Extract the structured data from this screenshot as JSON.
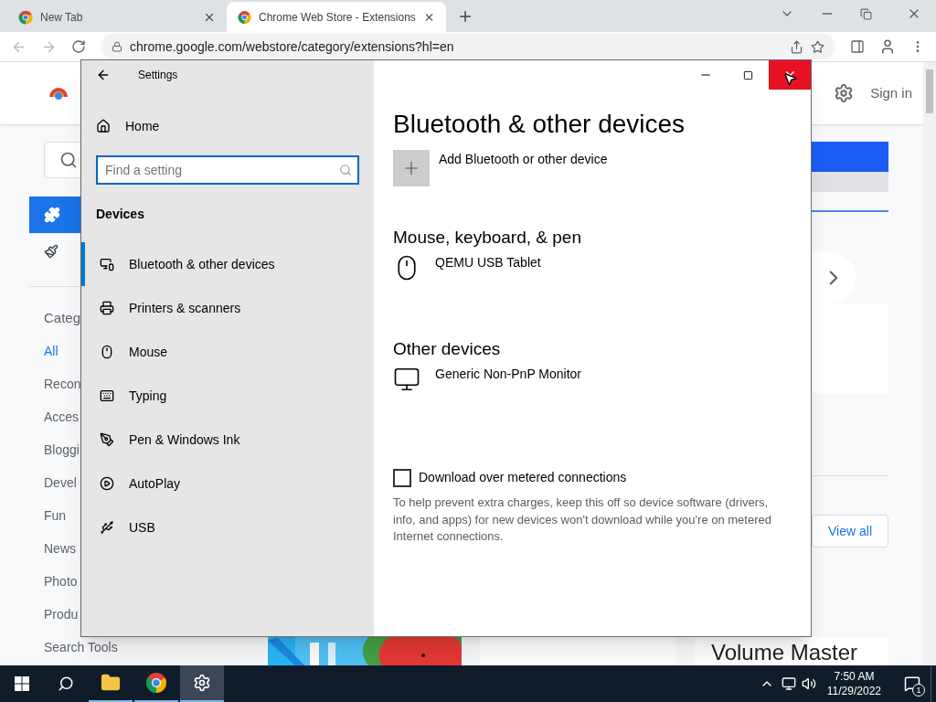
{
  "browser": {
    "tabs": [
      {
        "title": "New Tab",
        "selected": false
      },
      {
        "title": "Chrome Web Store - Extensions",
        "selected": true
      }
    ],
    "address_bar": {
      "url": "chrome.google.com/webstore/category/extensions?hl=en"
    },
    "page": {
      "sign_in": "Sign in",
      "categories_heading": "Categ",
      "categories": [
        {
          "label": "All",
          "selected": true
        },
        {
          "label": "Recon",
          "selected": false
        },
        {
          "label": "Acces",
          "selected": false
        },
        {
          "label": "Bloggi",
          "selected": false
        },
        {
          "label": "Devel",
          "selected": false
        },
        {
          "label": "Fun",
          "selected": false
        },
        {
          "label": "News",
          "selected": false
        },
        {
          "label": "Photo",
          "selected": false
        },
        {
          "label": "Produ",
          "selected": false
        },
        {
          "label": "Search Tools",
          "selected": false
        }
      ],
      "view_all": "View all",
      "card_title": "Volume Master"
    }
  },
  "settings": {
    "title": "Settings",
    "home": "Home",
    "search": {
      "placeholder": "Find a setting"
    },
    "section": "Devices",
    "nav": [
      {
        "label": "Bluetooth & other devices",
        "selected": true
      },
      {
        "label": "Printers & scanners",
        "selected": false
      },
      {
        "label": "Mouse",
        "selected": false
      },
      {
        "label": "Typing",
        "selected": false
      },
      {
        "label": "Pen & Windows Ink",
        "selected": false
      },
      {
        "label": "AutoPlay",
        "selected": false
      },
      {
        "label": "USB",
        "selected": false
      }
    ],
    "heading": "Bluetooth & other devices",
    "add_device": "Add Bluetooth or other device",
    "groups": [
      {
        "heading": "Mouse, keyboard, & pen",
        "devices": [
          {
            "name": "QEMU USB Tablet",
            "kind": "mouse"
          }
        ]
      },
      {
        "heading": "Other devices",
        "devices": [
          {
            "name": "Generic Non-PnP Monitor",
            "kind": "monitor"
          }
        ]
      }
    ],
    "metered": {
      "label": "Download over metered connections",
      "checked": false
    },
    "help": "To help prevent extra charges, keep this off so device software (drivers, info, and apps) for new devices won't download while you're on metered Internet connections."
  },
  "taskbar": {
    "apps": [
      {
        "kind": "explorer",
        "selected": false
      },
      {
        "kind": "chrome",
        "selected": false
      },
      {
        "kind": "settings",
        "selected": true
      }
    ],
    "time": "7:50 AM",
    "date": "11/29/2022",
    "notifications": "1"
  }
}
